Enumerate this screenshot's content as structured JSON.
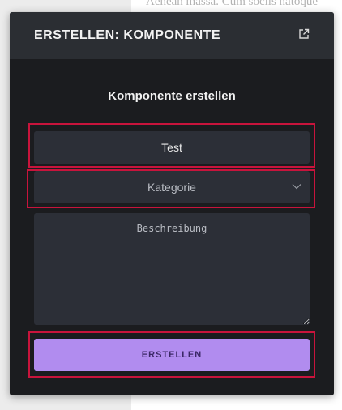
{
  "background": {
    "text": "Aenean massa. Cum sociis natoque"
  },
  "panel": {
    "title": "ERSTELLEN: KOMPONENTE",
    "open_icon": "external-link-icon"
  },
  "form": {
    "heading": "Komponente erstellen",
    "name": {
      "value": "Test"
    },
    "category": {
      "selected": "Kategorie",
      "icon": "chevron-down-icon"
    },
    "description": {
      "placeholder": "Beschreibung",
      "value": ""
    },
    "submit_label": "ERSTELLEN"
  },
  "colors": {
    "panel_bg": "#1b1c1f",
    "header_bg": "#2b2e33",
    "field_bg": "#2c2f37",
    "accent": "#b18cef",
    "highlight": "#c8143c"
  }
}
